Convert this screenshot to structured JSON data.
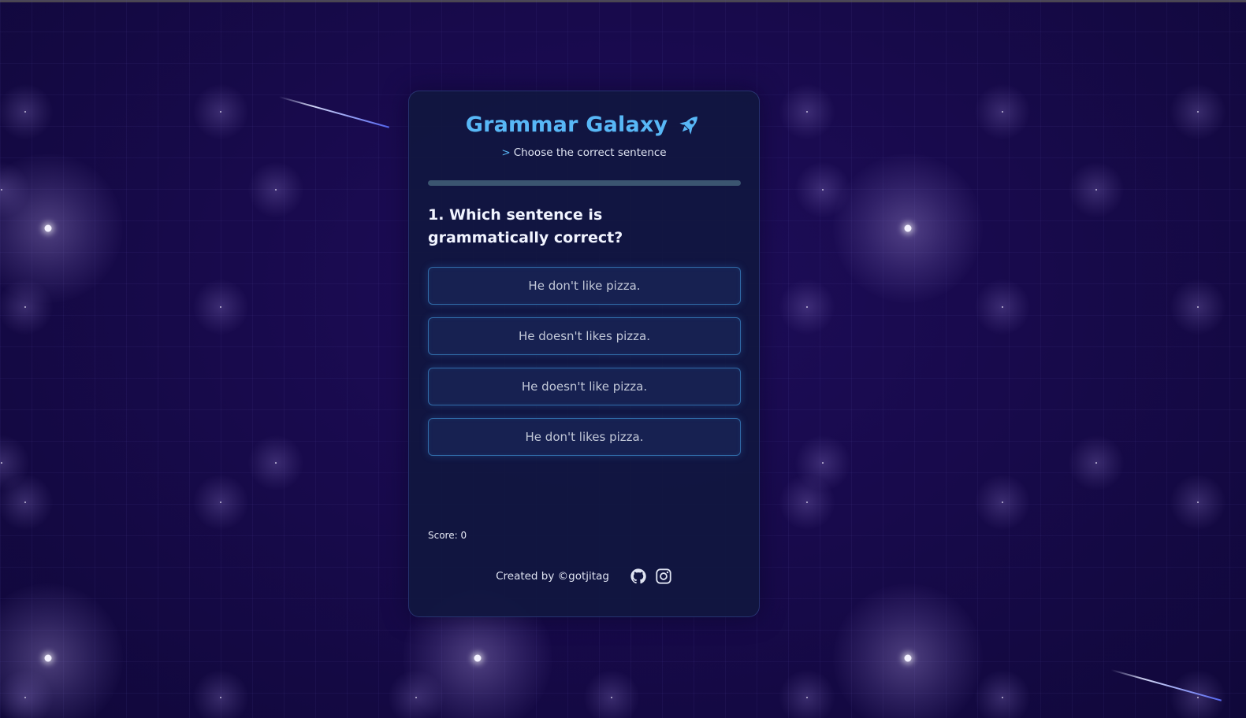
{
  "app": {
    "title": "Grammar Galaxy",
    "subtitle_prefix": ">",
    "subtitle": "Choose the correct sentence"
  },
  "quiz": {
    "progress_fraction": 0,
    "question": "1. Which sentence is grammatically correct?",
    "options": [
      "He don't like pizza.",
      "He doesn't likes pizza.",
      "He doesn't like pizza.",
      "He don't likes pizza."
    ],
    "score": "Score: 0"
  },
  "footer": {
    "credit": "Created by ©gotjitag",
    "icons": [
      "github-icon",
      "instagram-icon"
    ]
  },
  "colors": {
    "accent": "#58b7f6",
    "card_bg": "#11163f",
    "page_bg": "#180a4c"
  },
  "icons": {
    "title_icon": "rocket-icon"
  }
}
